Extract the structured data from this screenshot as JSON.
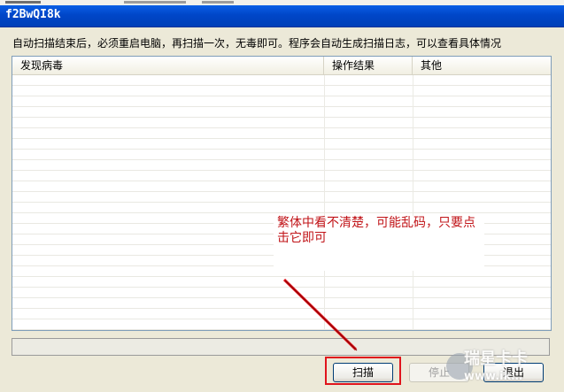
{
  "window": {
    "title": "f2BwQI8k"
  },
  "info_text": "自动扫描结束后，必须重启电脑，再扫描一次，无毒即可。程序会自动生成扫描日志，可以查看具体情况",
  "table": {
    "columns": [
      "发现病毒",
      "操作结果",
      "其他"
    ],
    "rows": []
  },
  "buttons": {
    "scan": "扫描",
    "stop": "停止",
    "exit": "退出"
  },
  "annotation": "繁体中看不清楚，可能乱码，只要点击它即可",
  "colors": {
    "title_bar": "#0046c8",
    "annotation_text": "#c11418",
    "highlight_box": "#e0141c"
  }
}
